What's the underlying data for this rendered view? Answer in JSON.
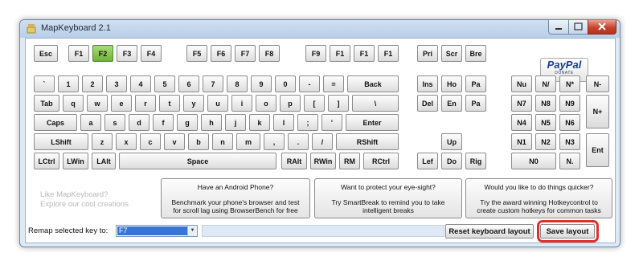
{
  "window": {
    "title": "MapKeyboard 2.1"
  },
  "keys": {
    "row0": [
      "Esc",
      "F1",
      "F2",
      "F3",
      "F4",
      "F5",
      "F6",
      "F7",
      "F8",
      "F9",
      "F1",
      "F1",
      "F1",
      "Pri",
      "Scr",
      "Bre"
    ],
    "row1": [
      "`",
      "1",
      "2",
      "3",
      "4",
      "5",
      "6",
      "7",
      "8",
      "9",
      "0",
      "-",
      "=",
      "Back",
      "Ins",
      "Ho",
      "Pa",
      "Nu",
      "N/",
      "N*",
      "N-"
    ],
    "row2": [
      "Tab",
      "q",
      "w",
      "e",
      "r",
      "t",
      "y",
      "u",
      "i",
      "o",
      "p",
      "[",
      "]",
      "\\",
      "Del",
      "En",
      "Pa",
      "N7",
      "N8",
      "N9",
      "N+"
    ],
    "row3": [
      "Caps",
      "a",
      "s",
      "d",
      "f",
      "g",
      "h",
      "j",
      "k",
      "l",
      ";",
      "'",
      "Enter",
      "N4",
      "N5",
      "N6"
    ],
    "row4": [
      "LShift",
      "z",
      "x",
      "c",
      "v",
      "b",
      "n",
      "m",
      ",",
      ".",
      "/",
      "RShift",
      "Up",
      "N1",
      "N2",
      "N3",
      "Ent"
    ],
    "row5": [
      "LCtrl",
      "LWin",
      "LAlt",
      "Space",
      "RAlt",
      "RWin",
      "RM",
      "RCtrl",
      "Lef",
      "Do",
      "Rig",
      "N0",
      "N."
    ],
    "active_key": "F2",
    "active_color": "#7fc04a"
  },
  "paypal": {
    "logo": "PayPal",
    "sub": "DONATE"
  },
  "promo": {
    "label_line1": "Like MapKeyboard?",
    "label_line2": "Explore our cool creations",
    "items": [
      {
        "heading": "Have an Android Phone?",
        "desc1": "Benchmark your phone's browser and test",
        "desc2": "for scroll lag using BrowserBench for free"
      },
      {
        "heading": "Want to protect your eye-sight?",
        "desc1": "Try SmartBreak to remind you to take",
        "desc2": "intelligent breaks"
      },
      {
        "heading": "Would you like to do things quicker?",
        "desc1": "Try the award winning Hotkeycontrol to",
        "desc2": "create custom hotkeys for common tasks"
      }
    ]
  },
  "remap": {
    "label": "Remap selected key to:",
    "value": "F7"
  },
  "buttons": {
    "reset": "Reset keyboard layout",
    "save": "Save layout"
  },
  "colors": {
    "highlight": "#e0302c",
    "selection": "#3875d7"
  }
}
